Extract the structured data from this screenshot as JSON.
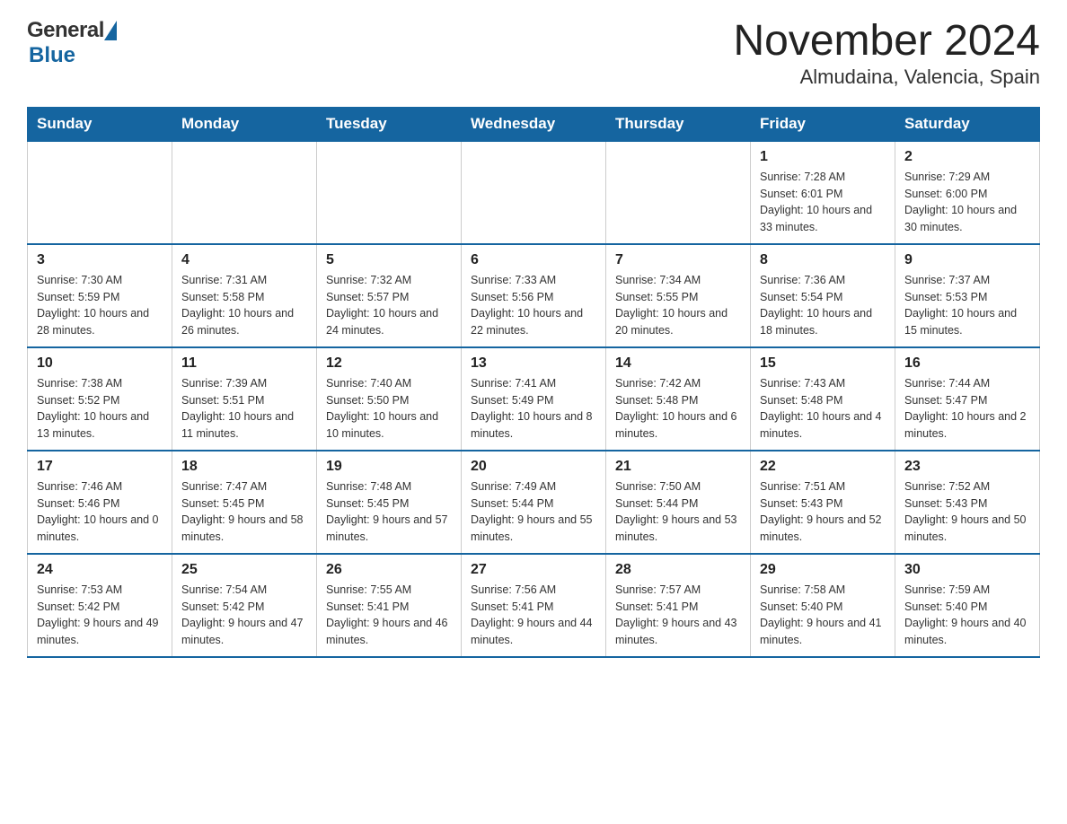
{
  "header": {
    "logo_text_black": "General",
    "logo_text_blue": "Blue",
    "month_title": "November 2024",
    "location": "Almudaina, Valencia, Spain"
  },
  "calendar": {
    "weekdays": [
      "Sunday",
      "Monday",
      "Tuesday",
      "Wednesday",
      "Thursday",
      "Friday",
      "Saturday"
    ],
    "weeks": [
      [
        {
          "day": "",
          "sunrise": "",
          "sunset": "",
          "daylight": ""
        },
        {
          "day": "",
          "sunrise": "",
          "sunset": "",
          "daylight": ""
        },
        {
          "day": "",
          "sunrise": "",
          "sunset": "",
          "daylight": ""
        },
        {
          "day": "",
          "sunrise": "",
          "sunset": "",
          "daylight": ""
        },
        {
          "day": "",
          "sunrise": "",
          "sunset": "",
          "daylight": ""
        },
        {
          "day": "1",
          "sunrise": "Sunrise: 7:28 AM",
          "sunset": "Sunset: 6:01 PM",
          "daylight": "Daylight: 10 hours and 33 minutes."
        },
        {
          "day": "2",
          "sunrise": "Sunrise: 7:29 AM",
          "sunset": "Sunset: 6:00 PM",
          "daylight": "Daylight: 10 hours and 30 minutes."
        }
      ],
      [
        {
          "day": "3",
          "sunrise": "Sunrise: 7:30 AM",
          "sunset": "Sunset: 5:59 PM",
          "daylight": "Daylight: 10 hours and 28 minutes."
        },
        {
          "day": "4",
          "sunrise": "Sunrise: 7:31 AM",
          "sunset": "Sunset: 5:58 PM",
          "daylight": "Daylight: 10 hours and 26 minutes."
        },
        {
          "day": "5",
          "sunrise": "Sunrise: 7:32 AM",
          "sunset": "Sunset: 5:57 PM",
          "daylight": "Daylight: 10 hours and 24 minutes."
        },
        {
          "day": "6",
          "sunrise": "Sunrise: 7:33 AM",
          "sunset": "Sunset: 5:56 PM",
          "daylight": "Daylight: 10 hours and 22 minutes."
        },
        {
          "day": "7",
          "sunrise": "Sunrise: 7:34 AM",
          "sunset": "Sunset: 5:55 PM",
          "daylight": "Daylight: 10 hours and 20 minutes."
        },
        {
          "day": "8",
          "sunrise": "Sunrise: 7:36 AM",
          "sunset": "Sunset: 5:54 PM",
          "daylight": "Daylight: 10 hours and 18 minutes."
        },
        {
          "day": "9",
          "sunrise": "Sunrise: 7:37 AM",
          "sunset": "Sunset: 5:53 PM",
          "daylight": "Daylight: 10 hours and 15 minutes."
        }
      ],
      [
        {
          "day": "10",
          "sunrise": "Sunrise: 7:38 AM",
          "sunset": "Sunset: 5:52 PM",
          "daylight": "Daylight: 10 hours and 13 minutes."
        },
        {
          "day": "11",
          "sunrise": "Sunrise: 7:39 AM",
          "sunset": "Sunset: 5:51 PM",
          "daylight": "Daylight: 10 hours and 11 minutes."
        },
        {
          "day": "12",
          "sunrise": "Sunrise: 7:40 AM",
          "sunset": "Sunset: 5:50 PM",
          "daylight": "Daylight: 10 hours and 10 minutes."
        },
        {
          "day": "13",
          "sunrise": "Sunrise: 7:41 AM",
          "sunset": "Sunset: 5:49 PM",
          "daylight": "Daylight: 10 hours and 8 minutes."
        },
        {
          "day": "14",
          "sunrise": "Sunrise: 7:42 AM",
          "sunset": "Sunset: 5:48 PM",
          "daylight": "Daylight: 10 hours and 6 minutes."
        },
        {
          "day": "15",
          "sunrise": "Sunrise: 7:43 AM",
          "sunset": "Sunset: 5:48 PM",
          "daylight": "Daylight: 10 hours and 4 minutes."
        },
        {
          "day": "16",
          "sunrise": "Sunrise: 7:44 AM",
          "sunset": "Sunset: 5:47 PM",
          "daylight": "Daylight: 10 hours and 2 minutes."
        }
      ],
      [
        {
          "day": "17",
          "sunrise": "Sunrise: 7:46 AM",
          "sunset": "Sunset: 5:46 PM",
          "daylight": "Daylight: 10 hours and 0 minutes."
        },
        {
          "day": "18",
          "sunrise": "Sunrise: 7:47 AM",
          "sunset": "Sunset: 5:45 PM",
          "daylight": "Daylight: 9 hours and 58 minutes."
        },
        {
          "day": "19",
          "sunrise": "Sunrise: 7:48 AM",
          "sunset": "Sunset: 5:45 PM",
          "daylight": "Daylight: 9 hours and 57 minutes."
        },
        {
          "day": "20",
          "sunrise": "Sunrise: 7:49 AM",
          "sunset": "Sunset: 5:44 PM",
          "daylight": "Daylight: 9 hours and 55 minutes."
        },
        {
          "day": "21",
          "sunrise": "Sunrise: 7:50 AM",
          "sunset": "Sunset: 5:44 PM",
          "daylight": "Daylight: 9 hours and 53 minutes."
        },
        {
          "day": "22",
          "sunrise": "Sunrise: 7:51 AM",
          "sunset": "Sunset: 5:43 PM",
          "daylight": "Daylight: 9 hours and 52 minutes."
        },
        {
          "day": "23",
          "sunrise": "Sunrise: 7:52 AM",
          "sunset": "Sunset: 5:43 PM",
          "daylight": "Daylight: 9 hours and 50 minutes."
        }
      ],
      [
        {
          "day": "24",
          "sunrise": "Sunrise: 7:53 AM",
          "sunset": "Sunset: 5:42 PM",
          "daylight": "Daylight: 9 hours and 49 minutes."
        },
        {
          "day": "25",
          "sunrise": "Sunrise: 7:54 AM",
          "sunset": "Sunset: 5:42 PM",
          "daylight": "Daylight: 9 hours and 47 minutes."
        },
        {
          "day": "26",
          "sunrise": "Sunrise: 7:55 AM",
          "sunset": "Sunset: 5:41 PM",
          "daylight": "Daylight: 9 hours and 46 minutes."
        },
        {
          "day": "27",
          "sunrise": "Sunrise: 7:56 AM",
          "sunset": "Sunset: 5:41 PM",
          "daylight": "Daylight: 9 hours and 44 minutes."
        },
        {
          "day": "28",
          "sunrise": "Sunrise: 7:57 AM",
          "sunset": "Sunset: 5:41 PM",
          "daylight": "Daylight: 9 hours and 43 minutes."
        },
        {
          "day": "29",
          "sunrise": "Sunrise: 7:58 AM",
          "sunset": "Sunset: 5:40 PM",
          "daylight": "Daylight: 9 hours and 41 minutes."
        },
        {
          "day": "30",
          "sunrise": "Sunrise: 7:59 AM",
          "sunset": "Sunset: 5:40 PM",
          "daylight": "Daylight: 9 hours and 40 minutes."
        }
      ]
    ]
  }
}
